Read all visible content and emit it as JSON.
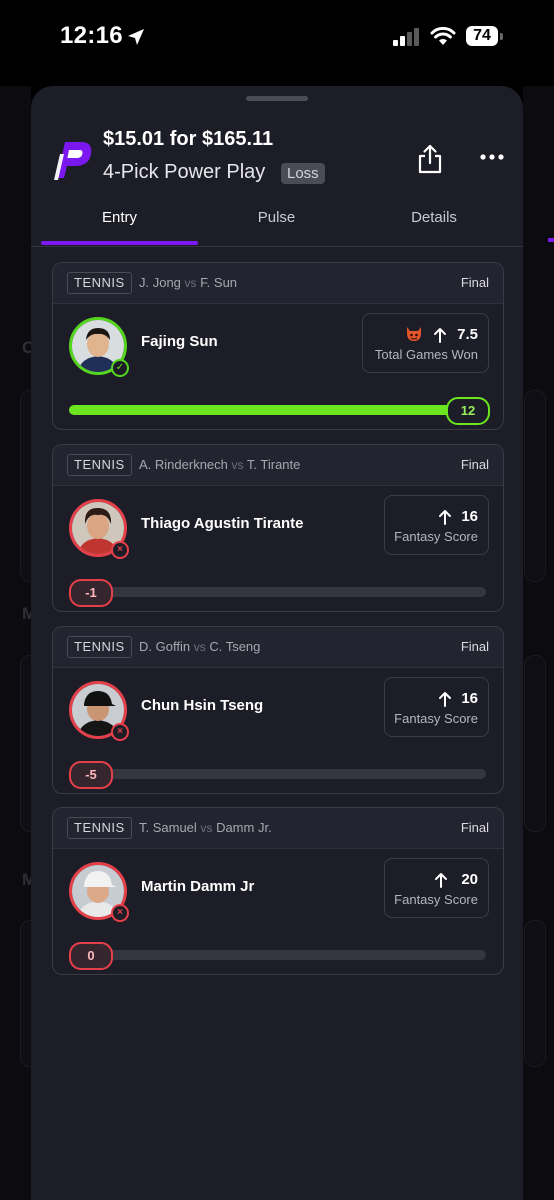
{
  "status_bar": {
    "time": "12:16",
    "battery": "74"
  },
  "entry": {
    "title": "$15.01 for $165.11",
    "subtitle": "4-Pick Power Play",
    "result_badge": "Loss"
  },
  "tabs": [
    {
      "label": "Entry",
      "active": true
    },
    {
      "label": "Pulse",
      "active": false
    },
    {
      "label": "Details",
      "active": false
    }
  ],
  "picks": [
    {
      "sport": "TENNIS",
      "matchup_a": "J. Jong",
      "vs": "vs",
      "matchup_b": "F. Sun",
      "status": "Final",
      "player": "Fajing Sun",
      "line": "7.5",
      "stat": "Total Games Won",
      "direction": "up",
      "demon_icon": true,
      "result": "win",
      "actual": "12",
      "progress": 1.0
    },
    {
      "sport": "TENNIS",
      "matchup_a": "A. Rinderknech",
      "vs": "vs",
      "matchup_b": "T. Tirante",
      "status": "Final",
      "player": "Thiago Agustin Tirante",
      "line": "16",
      "stat": "Fantasy Score",
      "direction": "up",
      "result": "loss",
      "actual": "-1",
      "progress": 0
    },
    {
      "sport": "TENNIS",
      "matchup_a": "D. Goffin",
      "vs": "vs",
      "matchup_b": "C. Tseng",
      "status": "Final",
      "player": "Chun Hsin Tseng",
      "line": "16",
      "stat": "Fantasy Score",
      "direction": "up",
      "result": "loss",
      "actual": "-5",
      "progress": 0
    },
    {
      "sport": "TENNIS",
      "matchup_a": "T. Samuel",
      "vs": "vs",
      "matchup_b": "Damm Jr.",
      "status": "Final",
      "player": "Martin Damm Jr",
      "line": "20",
      "stat": "Fantasy Score",
      "direction": "up",
      "result": "loss",
      "actual": "0",
      "progress": 0
    }
  ],
  "colors": {
    "accent": "#7b18ef",
    "win": "#6be51f",
    "loss": "#e5404a",
    "sheet_bg": "#1c1d27"
  }
}
